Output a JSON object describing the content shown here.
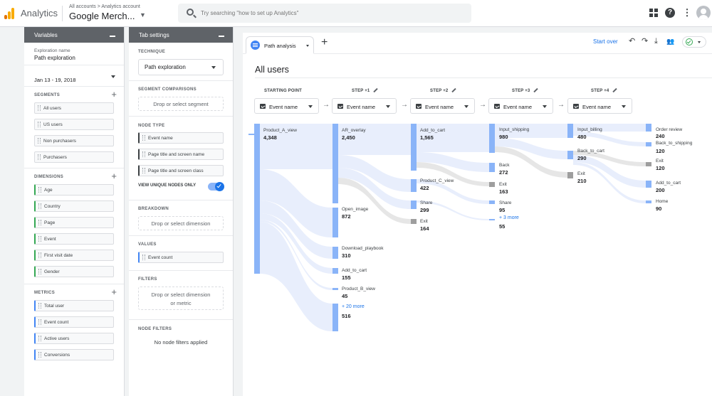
{
  "app": {
    "title": "Analytics",
    "breadcrumb_1": "All accounts",
    "breadcrumb_sep": ">",
    "breadcrumb_2": "Analytics account",
    "account": "Google Merch...",
    "search_placeholder": "Try searching \"how to set up Analytics\""
  },
  "variables": {
    "header": "Variables",
    "exploration_name_label": "Exploration name",
    "exploration_name": "Path exploration",
    "date_range": "Jan 13 - 19, 2018",
    "segments_title": "SEGMENTS",
    "segments": [
      "All users",
      "US users",
      "Non purchasers",
      "Purchasers"
    ],
    "dimensions_title": "DIMENSIONS",
    "dimensions": [
      "Age",
      "Country",
      "Page",
      "Event",
      "First visit date",
      "Gender"
    ],
    "metrics_title": "METRICS",
    "metrics": [
      "Total user",
      "Event count",
      "Active users",
      "Conversions"
    ]
  },
  "tab_settings": {
    "header": "Tab settings",
    "technique_title": "TECHNIQUE",
    "technique": "Path exploration",
    "segment_comparisons_title": "SEGMENT COMPARISONS",
    "segment_drop": "Drop or select segment",
    "node_type_title": "NODE TYPE",
    "node_types": [
      "Event name",
      "Page title and screen name",
      "Page title and screen class"
    ],
    "view_unique_nodes": "VIEW UNIQUE NODES ONLY",
    "view_unique_nodes_on": true,
    "breakdown_title": "BREAKDOWN",
    "breakdown_drop": "Drop or select dimension",
    "values_title": "VALUES",
    "values_chip": "Event count",
    "filters_title": "FILTERS",
    "filters_drop_1": "Drop or select dimension",
    "filters_drop_2": "or metric",
    "node_filters_title": "NODE FILTERS",
    "node_filters_text": "No node filters applied"
  },
  "canvas": {
    "tab_label": "Path analysis",
    "start_over": "Start over",
    "segment_title": "All users",
    "accent_color": "#4285f4",
    "flow_color": "#e8eefc",
    "exit_color": "#9e9e9e"
  },
  "steps": [
    {
      "label": "STARTING POINT",
      "selector": "Event name"
    },
    {
      "label": "STEP +1",
      "selector": "Event name"
    },
    {
      "label": "STEP +2",
      "selector": "Event name"
    },
    {
      "label": "STEP +3",
      "selector": "Event name"
    },
    {
      "label": "STEP +4",
      "selector": "Event name"
    }
  ],
  "nodes": {
    "step0": [
      {
        "name": "Product_A_view",
        "value": "4,348"
      }
    ],
    "step1": [
      {
        "name": "AR_overlay",
        "value": "2,450"
      },
      {
        "name": "Open_image",
        "value": "872"
      },
      {
        "name": "Download_playbook",
        "value": "310"
      },
      {
        "name": "Add_to_cart",
        "value": "155"
      },
      {
        "name": "Product_B_view",
        "value": "45"
      },
      {
        "name": "+ 20 more",
        "value": "516"
      }
    ],
    "step2": [
      {
        "name": "Add_to_cart",
        "value": "1,565"
      },
      {
        "name": "Product_C_view",
        "value": "422"
      },
      {
        "name": "Share",
        "value": "299"
      },
      {
        "name": "Exit",
        "value": "164"
      }
    ],
    "step3": [
      {
        "name": "Input_shipping",
        "value": "980"
      },
      {
        "name": "Back",
        "value": "272"
      },
      {
        "name": "Exit",
        "value": "163"
      },
      {
        "name": "Share",
        "value": "95"
      },
      {
        "name": "+ 3 more",
        "value": "55"
      }
    ],
    "step4": [
      {
        "name": "Input_billing",
        "value": "480"
      },
      {
        "name": "Back_to_cart",
        "value": "290"
      },
      {
        "name": "Exit",
        "value": "210"
      }
    ],
    "step5": [
      {
        "name": "Order review",
        "value": "240"
      },
      {
        "name": "Back_to_shipping",
        "value": "120"
      },
      {
        "name": "Exit",
        "value": "120"
      },
      {
        "name": "Add_to_cart",
        "value": "200"
      },
      {
        "name": "Home",
        "value": "90"
      }
    ]
  }
}
